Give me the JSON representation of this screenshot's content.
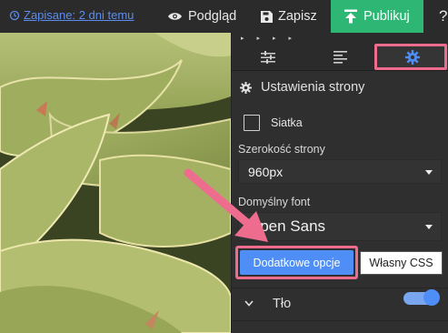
{
  "topbar": {
    "saved_label": "Zapisane: 2 dni temu",
    "preview_label": "Podgląd",
    "save_label": "Zapisz",
    "publish_label": "Publikuj",
    "help_label": "?"
  },
  "panel": {
    "mini_arrows": [
      "▸",
      "▸",
      "▸",
      "▸"
    ],
    "tabs": [
      {
        "icon": "sliders-icon"
      },
      {
        "icon": "align-left-icon"
      },
      {
        "icon": "gear-icon",
        "active": true
      }
    ],
    "section_title": "Ustawienia strony",
    "grid_label": "Siatka",
    "width_label": "Szerokość strony",
    "width_value": "960px",
    "font_label": "Domyślny font",
    "font_value": "Open Sans",
    "extra_options_label": "Dodatkowe opcje",
    "custom_css_label": "Własny CSS",
    "background_label": "Tło",
    "background_toggle_on": true
  },
  "colors": {
    "accent": "#4f8ef7",
    "publish": "#2db674",
    "highlight": "#ee6d8e"
  }
}
